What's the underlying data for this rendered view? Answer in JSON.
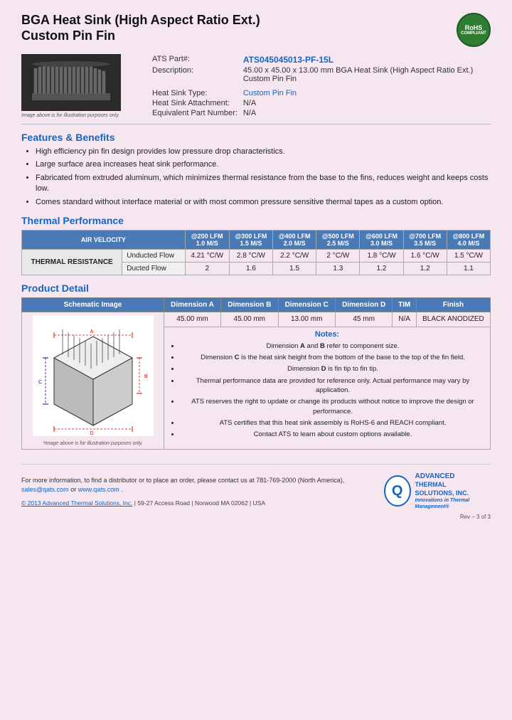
{
  "header": {
    "title_line1": "BGA Heat Sink (High Aspect Ratio Ext.)",
    "title_line2": "Custom Pin Fin",
    "rohs": {
      "line1": "RoHS",
      "line2": "COMPLIANT"
    }
  },
  "product": {
    "ats_part_label": "ATS Part#:",
    "ats_part_value": "ATS045045013-PF-15L",
    "description_label": "Description:",
    "description_value": "45.00 x 45.00 x 13.00 mm  BGA Heat Sink (High Aspect Ratio Ext.) Custom Pin Fin",
    "heat_sink_type_label": "Heat Sink Type:",
    "heat_sink_type_value": "Custom Pin Fin",
    "heat_sink_attachment_label": "Heat Sink Attachment:",
    "heat_sink_attachment_value": "N/A",
    "equivalent_part_label": "Equivalent Part Number:",
    "equivalent_part_value": "N/A",
    "image_caption": "Image above is for illustration purposes only."
  },
  "features": {
    "title": "Features & Benefits",
    "items": [
      "High efficiency pin fin design provides low pressure drop characteristics.",
      "Large surface area increases heat sink performance.",
      "Fabricated from extruded aluminum, which minimizes thermal resistance from the base to the fins, reduces weight and keeps costs low.",
      "Comes standard without interface material or with most common pressure sensitive thermal tapes as a custom option."
    ]
  },
  "thermal": {
    "title": "Thermal Performance",
    "air_velocity_label": "AIR VELOCITY",
    "columns": [
      "@200 LFM\n1.0 M/S",
      "@300 LFM\n1.5 M/S",
      "@400 LFM\n2.0 M/S",
      "@500 LFM\n2.5 M/S",
      "@600 LFM\n3.0 M/S",
      "@700 LFM\n3.5 M/S",
      "@800 LFM\n4.0 M/S"
    ],
    "section_label": "THERMAL RESISTANCE",
    "rows": [
      {
        "label": "Unducted Flow",
        "values": [
          "4.21 °C/W",
          "2.8 °C/W",
          "2.2 °C/W",
          "2 °C/W",
          "1.8 °C/W",
          "1.6 °C/W",
          "1.5 °C/W"
        ]
      },
      {
        "label": "Ducted Flow",
        "values": [
          "2",
          "1.6",
          "1.5",
          "1.3",
          "1.2",
          "1.2",
          "1.1"
        ]
      }
    ]
  },
  "product_detail": {
    "title": "Product Detail",
    "table_headers": [
      "Schematic Image",
      "Dimension A",
      "Dimension B",
      "Dimension C",
      "Dimension D",
      "TIM",
      "Finish"
    ],
    "dimensions": {
      "a": "45.00 mm",
      "b": "45.00 mm",
      "c": "13.00 mm",
      "d": "45 mm",
      "tim": "N/A",
      "finish": "BLACK ANODIZED"
    },
    "schematic_caption": "*Image above is for illustration purposes only.",
    "notes_title": "Notes:",
    "notes": [
      "Dimension A and B refer to component size.",
      "Dimension C is the heat sink height from the bottom of the base to the top of the fin field.",
      "Dimension D is fin tip to fin tip.",
      "Thermal performance data are provided for reference only. Actual performance may vary by application.",
      "ATS reserves the right to update or change its products without notice to improve the design or performance.",
      "ATS certifies that this heat sink assembly is RoHS-6 and REACH compliant.",
      "Contact ATS to learn about custom options available."
    ]
  },
  "footer": {
    "contact_text": "For more information, to find a distributor or to place an order, please contact us at",
    "phone": "781-769-2000 (North America),",
    "email": "sales@qats.com",
    "email_connector": " or ",
    "website": "www.qats.com",
    "website_suffix": ".",
    "copyright": "© 2013 Advanced Thermal Solutions, Inc.",
    "address": "| 59-27 Access Road  |  Norwood MA   02062  |  USA",
    "ats_logo_letter": "Q",
    "ats_name_line1": "ADVANCED",
    "ats_name_line2": "THERMAL",
    "ats_name_line3": "SOLUTIONS, INC.",
    "ats_tagline": "Innovations in Thermal Management®",
    "page_number": "Rev – 3 of 3"
  }
}
